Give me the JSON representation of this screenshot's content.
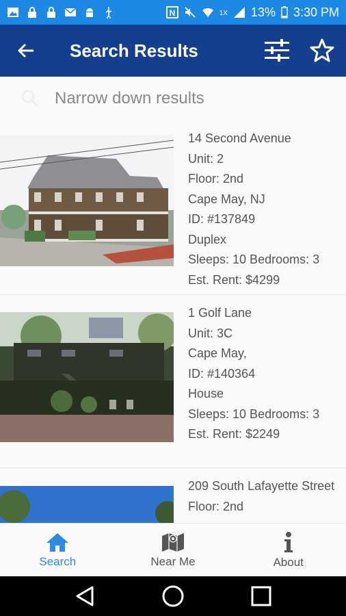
{
  "status_bar": {
    "icons_left": [
      "image-icon",
      "lock-icon",
      "lock-icon",
      "mail-icon",
      "android-icon",
      "usb-icon"
    ],
    "icons_right": [
      "nfc-icon",
      "mute-icon",
      "wifi-icon",
      "signal-icon"
    ],
    "network": "1X",
    "battery": "13%",
    "time": "3:30 PM"
  },
  "app_bar": {
    "title": "Search Results",
    "back_icon": "arrow-left-icon",
    "filter_icon": "sliders-icon",
    "favorite_icon": "star-outline-icon"
  },
  "filter": {
    "placeholder": "Narrow down results",
    "icon": "search-icon"
  },
  "listings": [
    {
      "address": "14 Second Avenue",
      "unit": "Unit: 2",
      "floor": "Floor: 2nd",
      "city": "Cape May, NJ",
      "id": "ID: #137849",
      "type": "Duplex",
      "sleeps_bedrooms": "Sleeps: 10  Bedrooms: 3",
      "rent": "Est. Rent: $4299"
    },
    {
      "address": "1 Golf Lane",
      "unit": "Unit: 3C",
      "city": "Cape May,",
      "id": "ID: #140364",
      "type": "House",
      "sleeps_bedrooms": "Sleeps: 10  Bedrooms: 3",
      "rent": "Est. Rent: $2249"
    },
    {
      "address": "209 South Lafayette Street",
      "floor": "Floor: 2nd"
    }
  ],
  "bottom_nav": [
    {
      "label": "Search",
      "icon": "home-icon",
      "active": true
    },
    {
      "label": "Near Me",
      "icon": "map-icon",
      "active": false
    },
    {
      "label": "About",
      "icon": "info-icon",
      "active": false
    }
  ],
  "system_nav": [
    "back-triangle-icon",
    "home-circle-icon",
    "recents-square-icon"
  ],
  "colors": {
    "status_bar": "#1e88e5",
    "app_bar": "#153e8c",
    "active_tab": "#2e8be0"
  }
}
